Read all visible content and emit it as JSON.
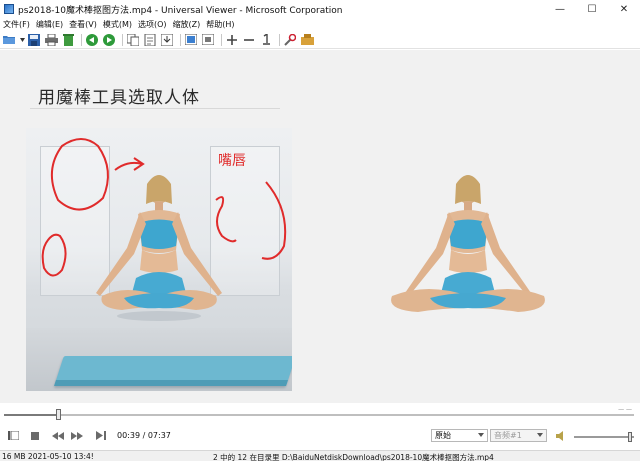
{
  "window": {
    "title": "ps2018-10魔术棒抠图方法.mp4 - Universal Viewer - Microsoft Corporation",
    "controls": {
      "minimize": "—",
      "maximize": "☐",
      "close": "✕"
    }
  },
  "menu": {
    "items": [
      "文件(F)",
      "编辑(E)",
      "查看(V)",
      "模式(M)",
      "选项(O)",
      "缩放(Z)",
      "帮助(H)"
    ]
  },
  "toolbar": {
    "icons": [
      "open-icon",
      "dropdown-icon",
      "save-icon",
      "print-icon",
      "recycle-icon",
      "back-arrow-icon",
      "forward-arrow-icon",
      "copy-icon",
      "copy-file-icon",
      "export-icon",
      "fullscreen-icon",
      "fit-window-icon",
      "zoom-in-icon",
      "zoom-out-icon",
      "original-size-icon",
      "settings-icon",
      "plugin-icon"
    ]
  },
  "video": {
    "slide_title": "用魔棒工具选取人体",
    "annotation_text": "嘴唇"
  },
  "player": {
    "time": "00:39 / 07:37",
    "progress": 0.085,
    "seek_end_label": "— —",
    "mode_select": "原始",
    "track_select": "音频#1",
    "volume": 0.97,
    "accent_annotation_color": "#e02b2b",
    "icons": [
      "prev-frame-icon",
      "stop-icon",
      "rewind-icon",
      "fast-forward-icon",
      "next-frame-icon",
      "volume-icon"
    ]
  },
  "status": {
    "left": "16 MB  2021-05-10 13:4!",
    "middle": "2 中的 12  在目录里 D:\\BaiduNetdiskDownload\\ps2018-10魔术棒抠图方法.mp4"
  }
}
